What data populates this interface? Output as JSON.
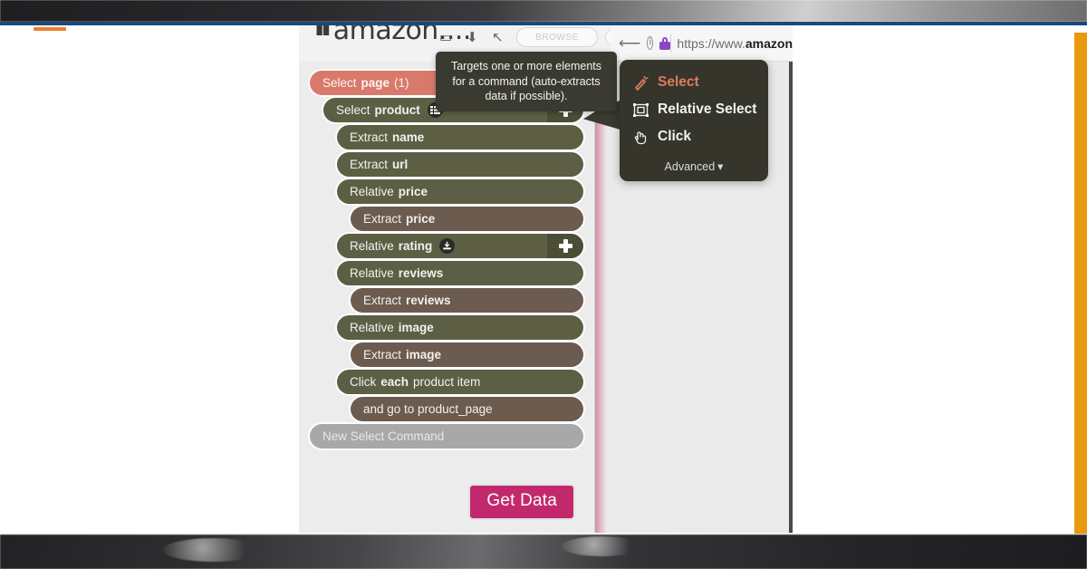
{
  "browser": {
    "url_prefix": "https://www.",
    "url_domain": "amazon",
    "back_icon": "back-arrow-icon",
    "info_icon": "info-icon",
    "lock_icon": "lock-icon"
  },
  "site_header": {
    "logo_text": "amazon....",
    "menu_bars_icon": "hamburger-icon",
    "icons": [
      "window-icon",
      "download-icon",
      "cursor-icon"
    ],
    "browse_label": "BROWSE"
  },
  "tooltip": {
    "text": "Targets one or more elements for a command (auto-extracts data if possible)."
  },
  "context_menu": {
    "items": [
      {
        "label": "Select",
        "icon": "wand-icon",
        "active": true
      },
      {
        "label": "Relative Select",
        "icon": "relative-select-icon",
        "active": false
      },
      {
        "label": "Click",
        "icon": "pointer-hand-icon",
        "active": false
      }
    ],
    "advanced_label": "Advanced",
    "advanced_caret": "caret-down-icon",
    "active_color": "#e07a5f",
    "background": "#35352c"
  },
  "workflow": {
    "rows": [
      {
        "verb": "Select",
        "kw": "page",
        "tail": "(1)",
        "style": "salmon",
        "indent": 0,
        "plus": true,
        "icon": null
      },
      {
        "verb": "Select",
        "kw": "product",
        "tail": "",
        "style": "olive",
        "indent": 1,
        "plus": true,
        "icon": "list-icon"
      },
      {
        "verb": "Extract",
        "kw": "name",
        "tail": "",
        "style": "olive",
        "indent": 2,
        "plus": false,
        "icon": null
      },
      {
        "verb": "Extract",
        "kw": "url",
        "tail": "",
        "style": "olive",
        "indent": 2,
        "plus": false,
        "icon": null
      },
      {
        "verb": "Relative",
        "kw": "price",
        "tail": "",
        "style": "olive",
        "indent": 2,
        "plus": false,
        "icon": null
      },
      {
        "verb": "Extract",
        "kw": "price",
        "tail": "",
        "style": "brown",
        "indent": 3,
        "plus": false,
        "icon": null
      },
      {
        "verb": "Relative",
        "kw": "rating",
        "tail": "",
        "style": "olive",
        "indent": 2,
        "plus": true,
        "icon": "download-badge-icon"
      },
      {
        "verb": "Relative",
        "kw": "reviews",
        "tail": "",
        "style": "olive",
        "indent": 2,
        "plus": false,
        "icon": null
      },
      {
        "verb": "Extract",
        "kw": "reviews",
        "tail": "",
        "style": "brown",
        "indent": 3,
        "plus": false,
        "icon": null
      },
      {
        "verb": "Relative",
        "kw": "image",
        "tail": "",
        "style": "olive",
        "indent": 2,
        "plus": false,
        "icon": null
      },
      {
        "verb": "Extract",
        "kw": "image",
        "tail": "",
        "style": "brown",
        "indent": 3,
        "plus": false,
        "icon": null
      },
      {
        "verb": "Click",
        "kw": "each",
        "tail": "product item",
        "style": "olive",
        "indent": 2,
        "plus": false,
        "icon": null
      },
      {
        "verb": "and go to product_page",
        "kw": "",
        "tail": "",
        "style": "brown",
        "indent": 3,
        "plus": false,
        "icon": null
      },
      {
        "verb": "New Select Command",
        "kw": "",
        "tail": "",
        "style": "gray",
        "indent": 0,
        "plus": false,
        "icon": null
      }
    ],
    "get_data_label": "Get Data",
    "get_data_color": "#c2296d"
  }
}
